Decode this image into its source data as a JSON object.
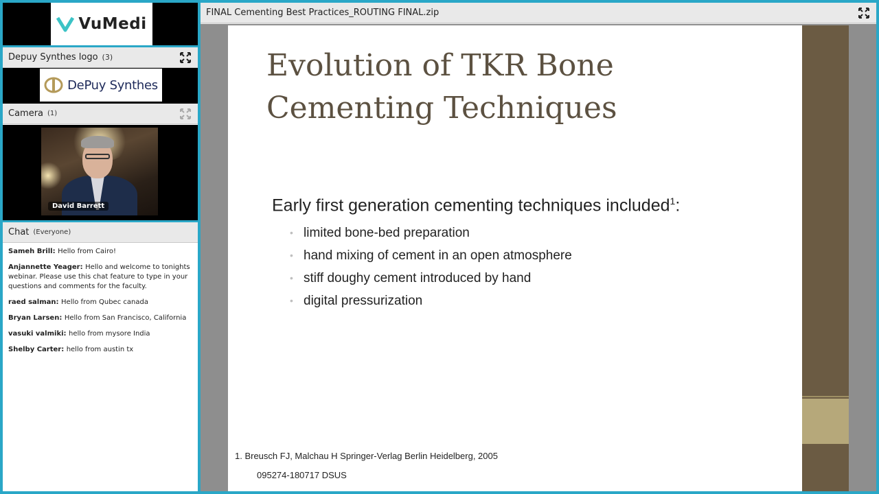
{
  "vumedi": {
    "logo_text": "VuMedi"
  },
  "depuy_pod": {
    "title": "Depuy Synthes logo",
    "count": "(3)",
    "logo_text": "DePuy Synthes"
  },
  "camera_pod": {
    "title": "Camera",
    "count": "(1)",
    "presenter_name": "David Barrett"
  },
  "chat_pod": {
    "title": "Chat",
    "scope": "(Everyone)",
    "messages": [
      {
        "sender": "Sameh Brill",
        "text": "Hello from Cairo!"
      },
      {
        "sender": "Anjannette Yeager",
        "text": "Hello and welcome to tonights webinar. Please use this chat feature to type in your questions and comments for the faculty."
      },
      {
        "sender": "raed salman",
        "text": "Hello from Qubec canada"
      },
      {
        "sender": "Bryan Larsen",
        "text": "Hello from San Francisco, California"
      },
      {
        "sender": "vasuki valmiki",
        "text": "hello from mysore India"
      },
      {
        "sender": "Shelby Carter",
        "text": "hello from austin tx"
      }
    ]
  },
  "share_pod": {
    "title": "FINAL Cementing Best Practices_ROUTING FINAL.zip",
    "slide": {
      "title": "Evolution of TKR Bone Cementing Techniques",
      "lead": "Early first generation cementing techniques included",
      "lead_sup": "1",
      "lead_suffix": ":",
      "bullets": [
        "limited bone-bed preparation",
        "hand mixing of cement in an open atmosphere",
        "stiff doughy cement introduced by hand",
        "digital pressurization"
      ],
      "reference": "1. Breusch FJ, Malchau H Springer-Verlag Berlin Heidelberg, 2005",
      "code": "095274-180717 DSUS"
    }
  },
  "colors": {
    "frame": "#2aa7c7",
    "slide_title": "#5c5141",
    "side_strip": "#6b5b43",
    "side_block": "#b6a87a",
    "vumedi_teal": "#3cc3c6"
  },
  "icons": {
    "expand": "expand-arrows-icon",
    "vumedi_mark": "vumedi-v-icon",
    "depuy_mark": "depuy-emblem-icon"
  }
}
